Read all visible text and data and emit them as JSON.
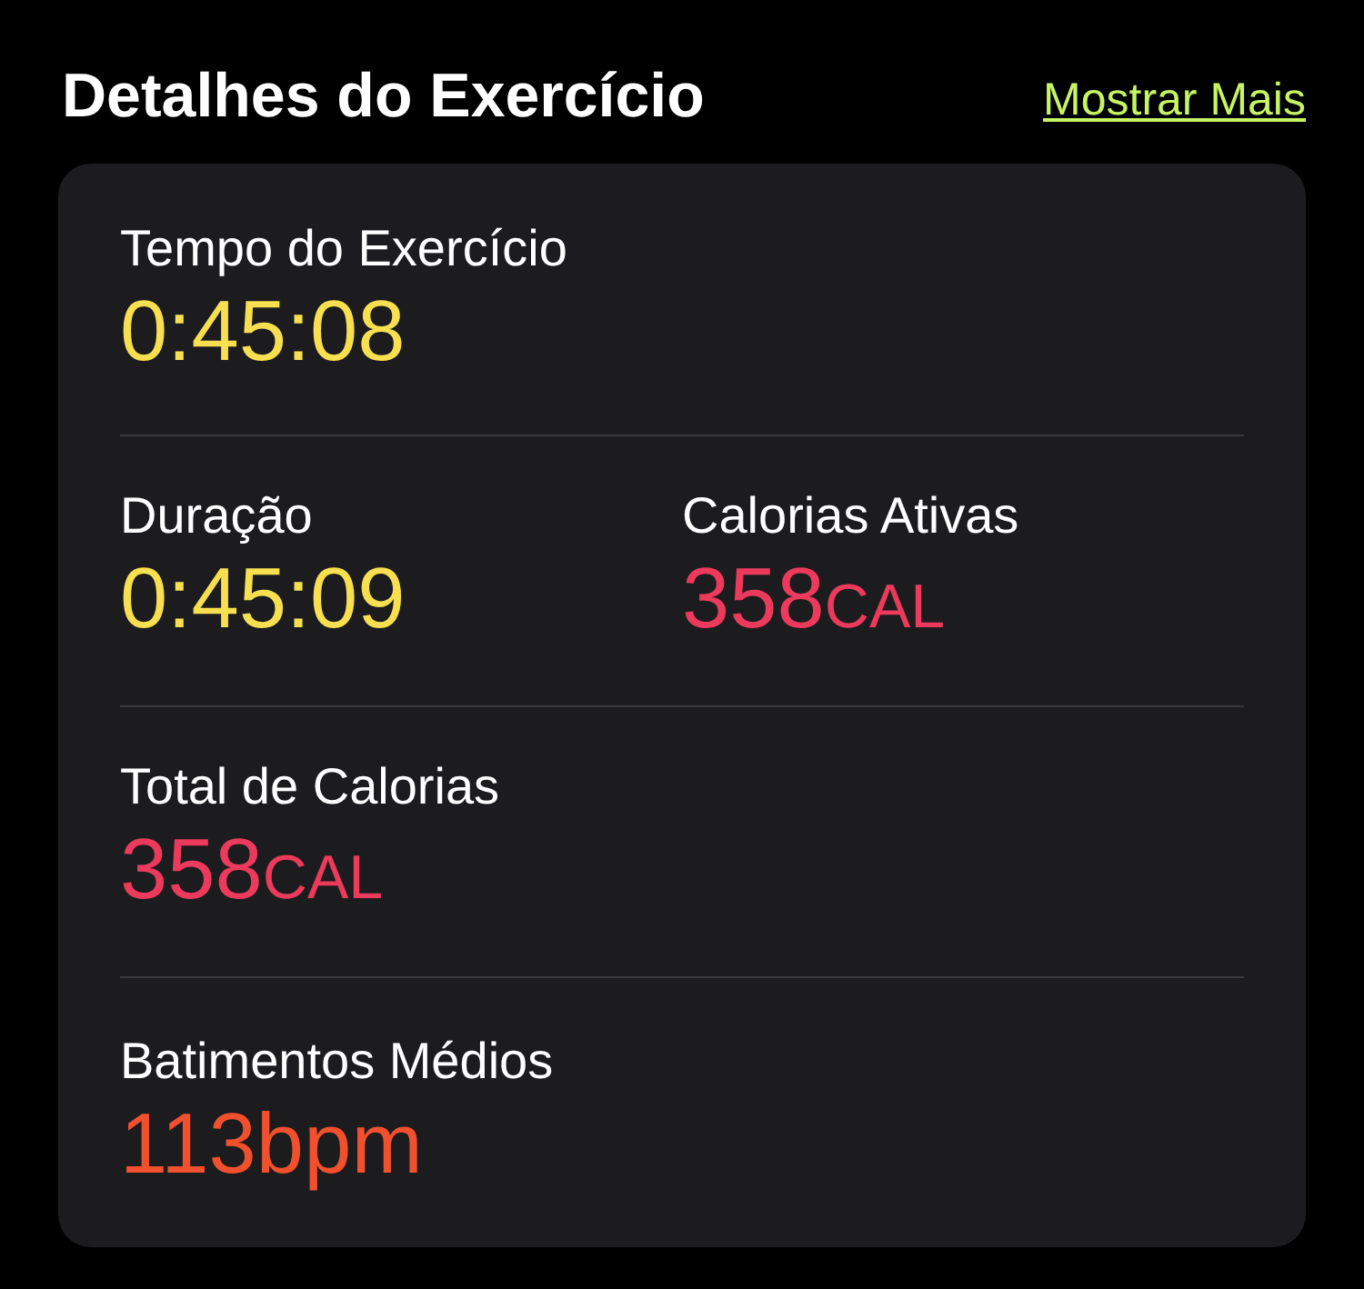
{
  "header": {
    "title": "Detalhes do Exercício",
    "link": "Mostrar Mais"
  },
  "rows": [
    [
      {
        "label": "Tempo do Exercício",
        "value": "0:45:08",
        "color": "#f7df4f"
      }
    ],
    [
      {
        "label": "Duração",
        "value": "0:45:09",
        "color": "#f7df4f"
      },
      {
        "label": "Calorias Ativas",
        "value": "358",
        "unit": "CAL",
        "color": "#ec3a5c"
      }
    ],
    [
      {
        "label": "Total de Calorias",
        "value": "358",
        "unit": "CAL",
        "color": "#ec3a5c"
      }
    ],
    [
      {
        "label": "Batimentos Médios",
        "value": "113bpm",
        "color": "#f0502e"
      }
    ]
  ]
}
